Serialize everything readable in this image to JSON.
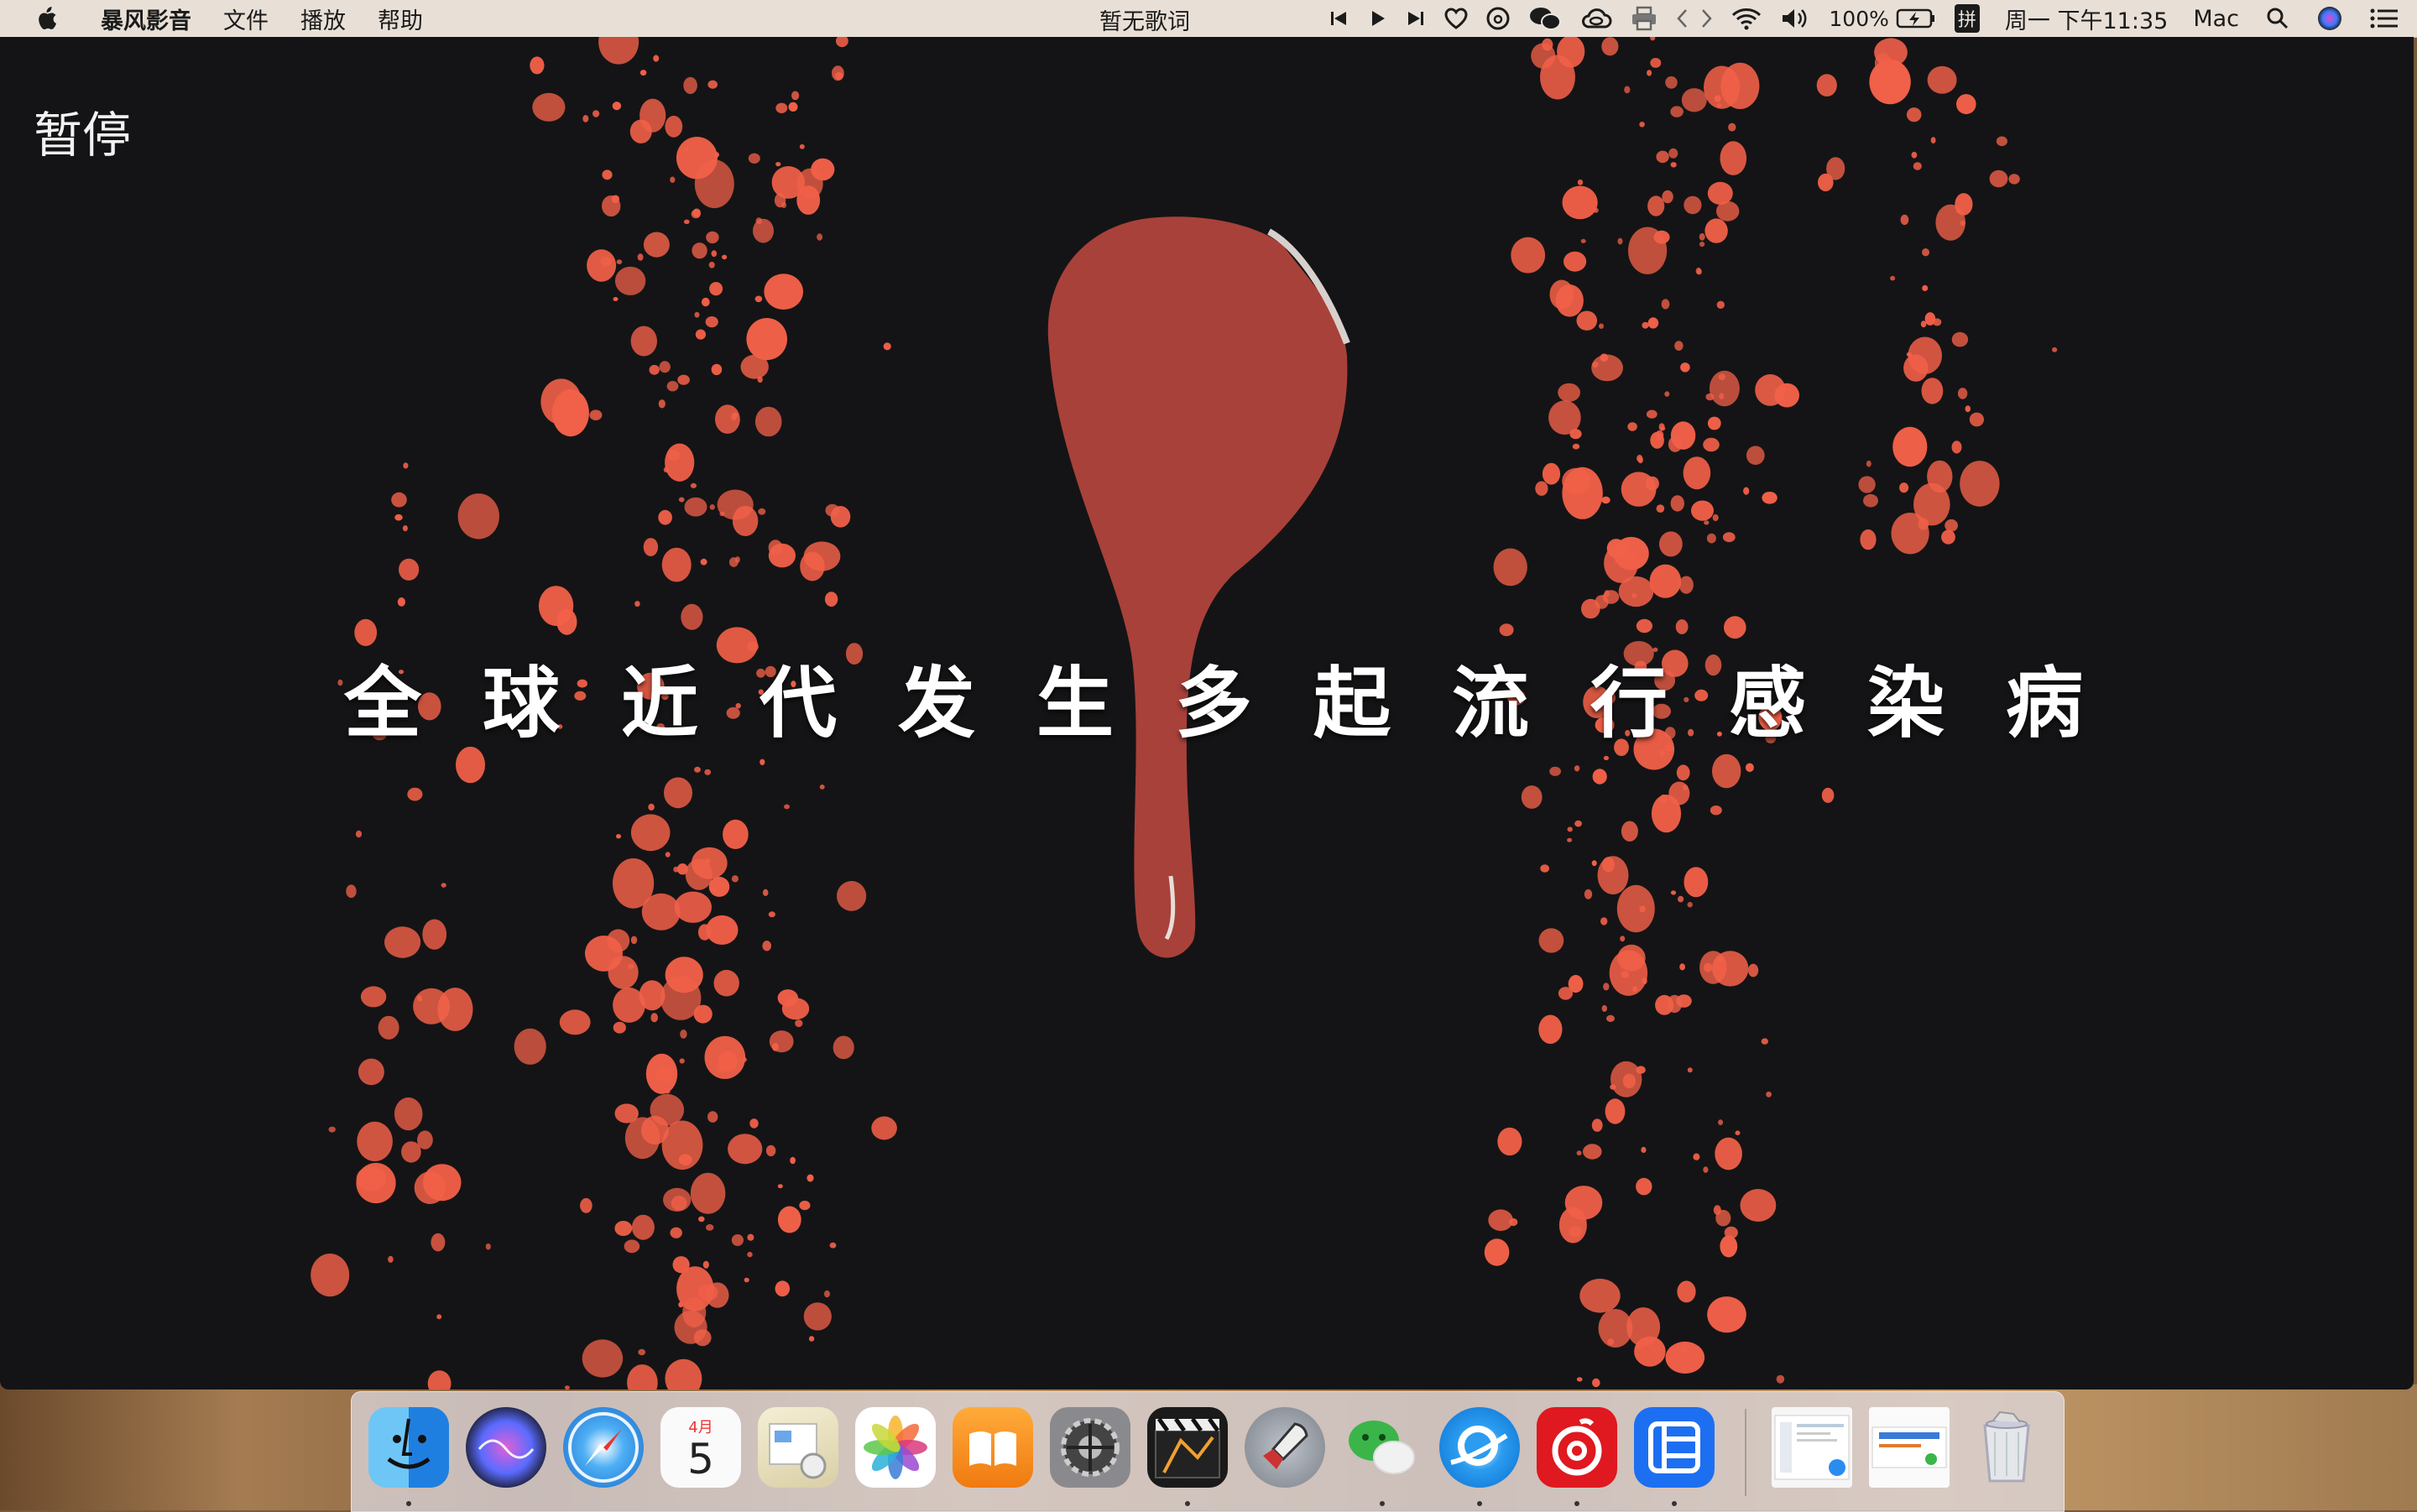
{
  "menubar": {
    "apple_icon": "apple-logo-icon",
    "app_name": "暴风影音",
    "menus": [
      "文件",
      "播放",
      "帮助"
    ],
    "lyrics_text": "暂无歌词",
    "battery_percent": "100%",
    "input_method": "拼",
    "datetime": "周一 下午11:35",
    "user_name": "Mac",
    "icons": [
      "previous-track-icon",
      "play-icon",
      "next-track-icon",
      "heart-icon",
      "netease-music-icon",
      "wechat-icon",
      "creative-cloud-icon",
      "printer-icon",
      "code-brackets-icon",
      "wifi-icon",
      "volume-icon",
      "battery-charging-icon",
      "search-icon",
      "siri-icon",
      "notification-center-icon"
    ]
  },
  "player": {
    "pause_label": "暂停",
    "subtitle": "全球近代发生多起流行感染病"
  },
  "dock": {
    "calendar_month": "4月",
    "calendar_day": "5",
    "apps": [
      "finder-icon",
      "siri-icon",
      "safari-icon",
      "calendar-icon",
      "preview-icon",
      "photos-icon",
      "ibooks-icon",
      "system-preferences-icon",
      "final-cut-pro-icon",
      "launchpad-icon",
      "wechat-icon",
      "qq-browser-icon",
      "netease-music-icon",
      "iqiyi-list-icon",
      "recent-document-1-icon",
      "recent-document-2-icon",
      "trash-icon"
    ]
  },
  "colors": {
    "splatter": "#f16048",
    "drip": "#a8413a",
    "video_bg": "#141416",
    "menubar_bg": "#ece6de"
  }
}
